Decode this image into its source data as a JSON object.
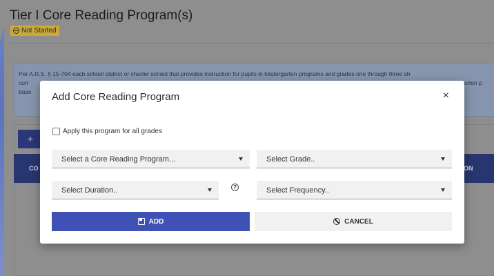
{
  "page": {
    "title": "Tier I Core Reading Program(s)",
    "status": "Not Started",
    "info_line1": "Per A.R.S. § 15-704 each school district or charter school that provides instruction for pupils in kindergarten programs and grades one through three sh",
    "info_line2": "curr",
    "info_line2_right": "ergarten p",
    "info_line3": "base",
    "add_button_glyph": "+",
    "table_col_left": "CO",
    "table_col_right": "ON"
  },
  "modal": {
    "title": "Add Core Reading Program",
    "close_glyph": "×",
    "all_grades_label": "Apply this program for all grades",
    "program_select": "Select a Core Reading Program...",
    "grade_select": "Select Grade..",
    "duration_select": "Select Duration..",
    "frequency_select": "Select Frequency..",
    "help_glyph": "?",
    "add_label": "ADD",
    "cancel_label": "CANCEL"
  },
  "colors": {
    "primary": "#3f51b5",
    "badge": "#c9a93a"
  }
}
